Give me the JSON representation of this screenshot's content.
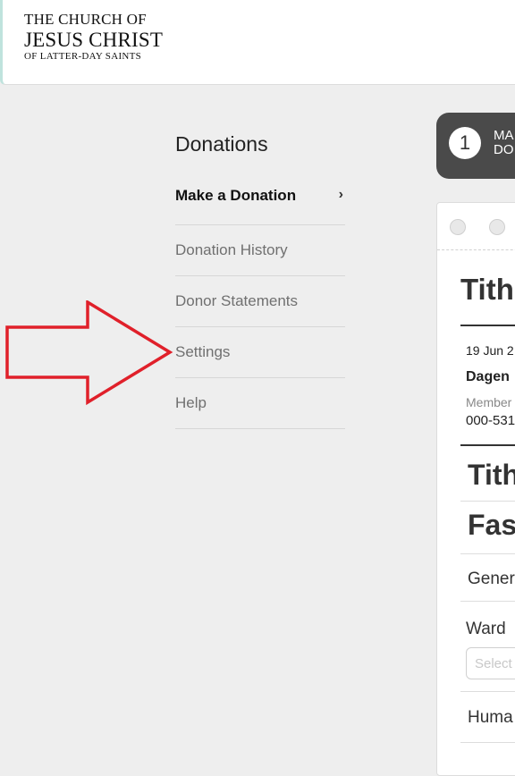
{
  "logo": {
    "line1": "THE CHURCH OF",
    "line2": "JESUS CHRIST",
    "line3": "OF LATTER-DAY SAINTS"
  },
  "sidenav": {
    "title": "Donations",
    "items": [
      {
        "label": "Make a Donation",
        "active": true
      },
      {
        "label": "Donation History"
      },
      {
        "label": "Donor Statements"
      },
      {
        "label": "Settings"
      },
      {
        "label": "Help"
      }
    ]
  },
  "stepper": {
    "number": "1",
    "line1": "MA",
    "line2": "DO"
  },
  "form": {
    "title": "Tith",
    "date": "19 Jun 2",
    "name": "Dagen",
    "member_label": "Member",
    "member_number": "000-531",
    "rows": [
      {
        "label": "Tith"
      },
      {
        "label": "Fas"
      },
      {
        "label": "Gener"
      },
      {
        "label": "Ward"
      },
      {
        "label": "Huma"
      }
    ],
    "select_placeholder": "Select"
  },
  "colors": {
    "annotation_arrow": "#e0202a",
    "stepper_bg": "#4a4a4a"
  }
}
